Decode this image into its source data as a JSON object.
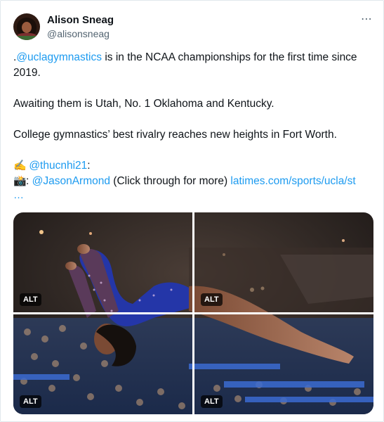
{
  "author": {
    "name": "Alison Sneag",
    "handle": "@alisonsneag"
  },
  "more_icon": "⋯",
  "tweet": {
    "line1_prefix": ".",
    "line1_link": "@uclagymnastics",
    "line1_rest": " is in the NCAA championships for the first time since",
    "line2": "2019.",
    "line3": "Awaiting them is Utah, No. 1 Oklahoma and Kentucky.",
    "line4": "College gymnastics’ best rivalry reaches new heights in Fort Worth.",
    "writer_emoji": "✍️",
    "writer_link": "@thucnhi21",
    "writer_suffix": ":",
    "camera_emoji": "📸",
    "camera_sep": ": ",
    "photographer_link": "@JasonArmond",
    "click_note": " (Click through for more) ",
    "url_link": "latimes.com/sports/ucla/st",
    "ellipsis": "…"
  },
  "media": {
    "alt_labels": [
      "ALT",
      "ALT",
      "ALT",
      "ALT"
    ]
  },
  "colors": {
    "link": "#1d9bf0",
    "text": "#0f1419",
    "muted": "#536471",
    "leotard": "#2436a8"
  }
}
